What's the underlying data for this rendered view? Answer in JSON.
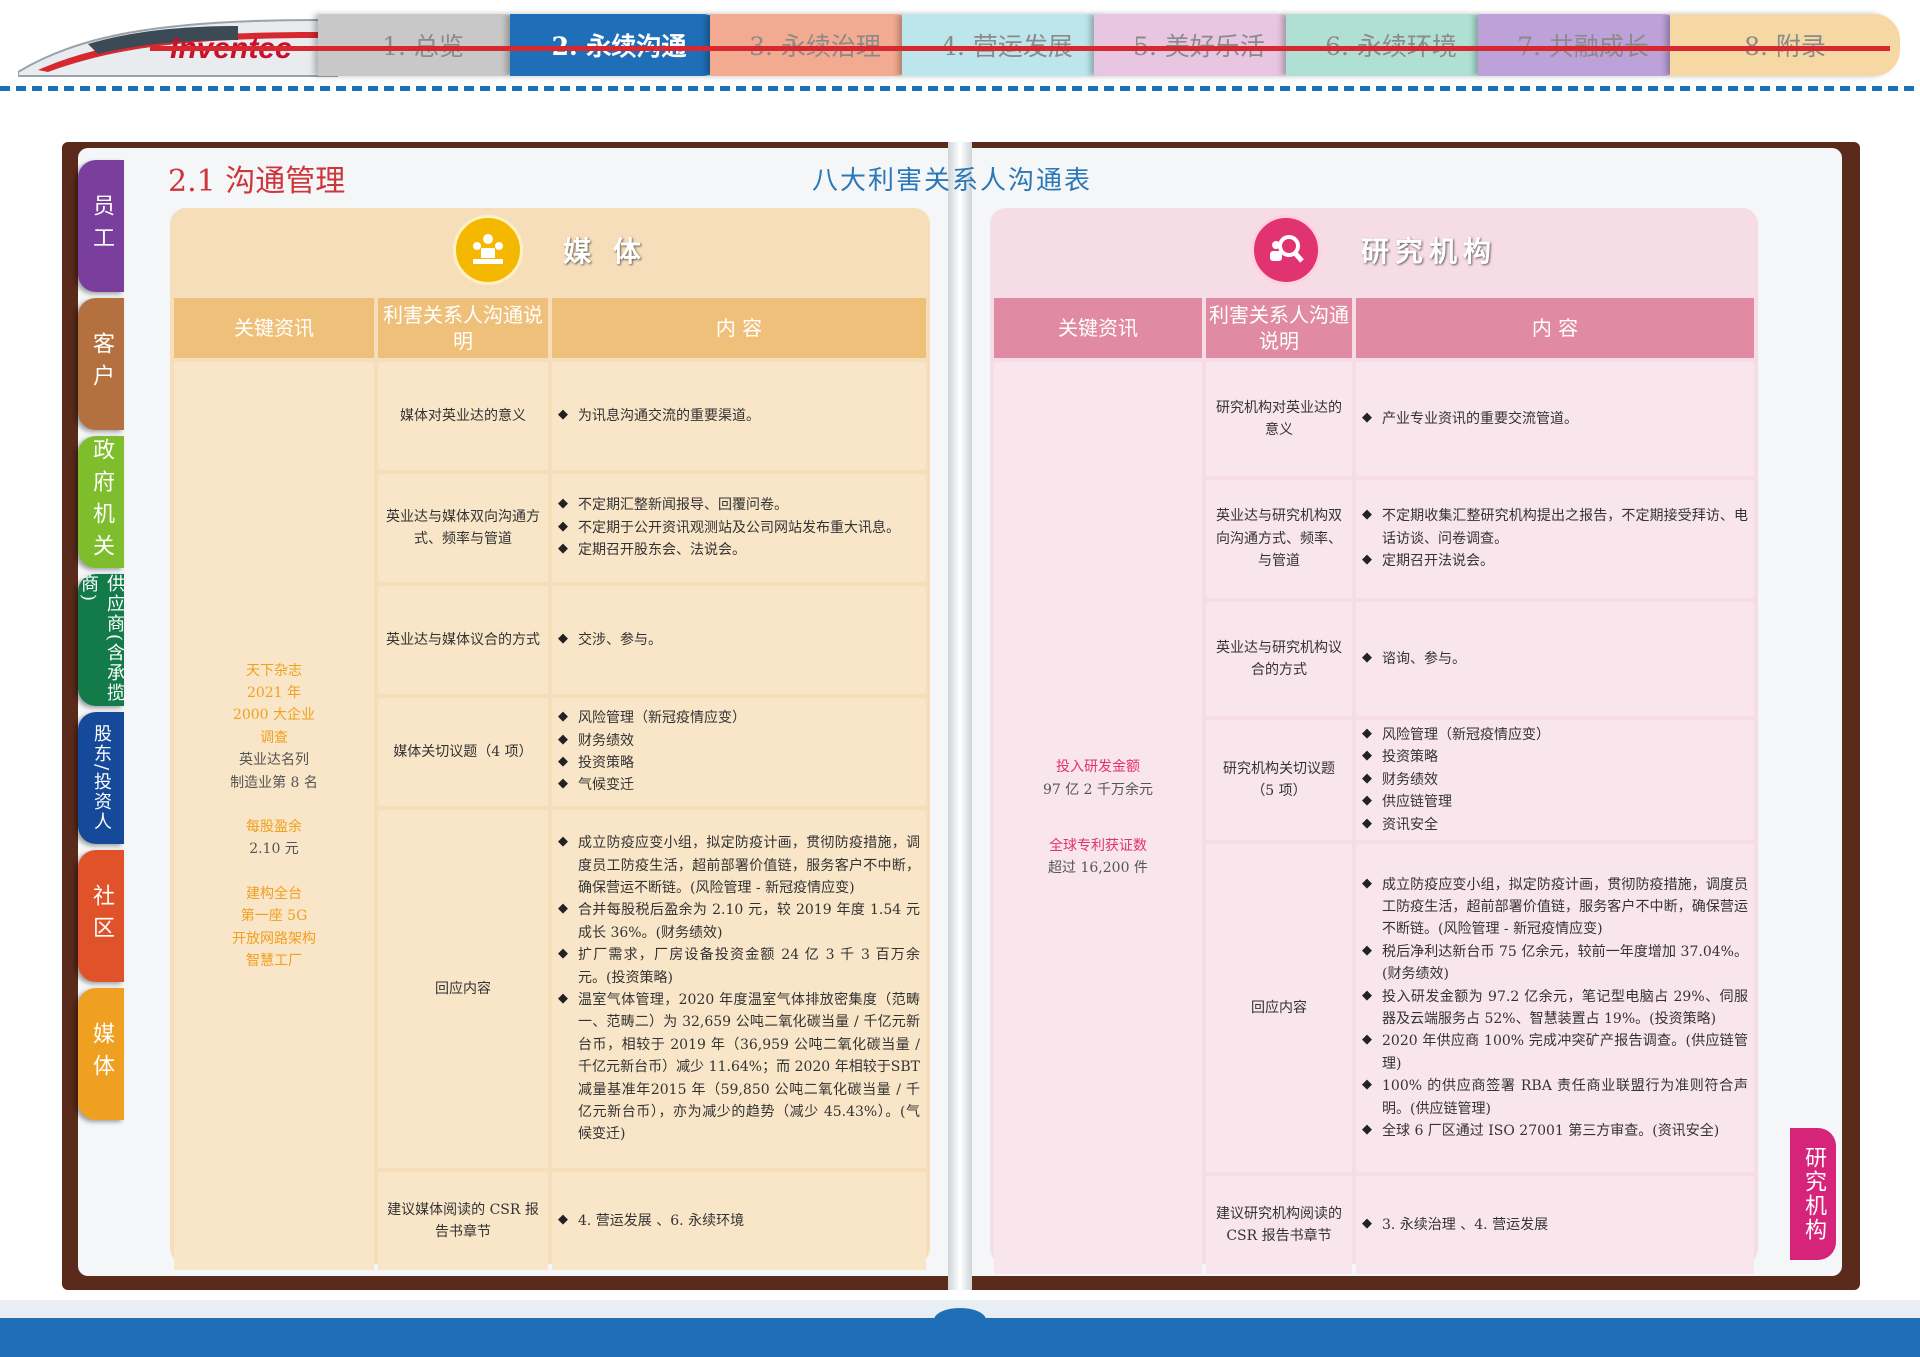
{
  "brand": {
    "logo_text": "Inventec"
  },
  "nav": {
    "tabs": [
      {
        "label": "1. 总览",
        "color": "#b9b9b9",
        "active": false
      },
      {
        "label": "2. 永续沟通",
        "color": "#1f6fb8",
        "active": true
      },
      {
        "label": "3. 永续治理",
        "color": "#f0a48a",
        "active": false
      },
      {
        "label": "4. 营运发展",
        "color": "#b7e3ea",
        "active": false
      },
      {
        "label": "5. 美好乐活",
        "color": "#e6bfe0",
        "active": false
      },
      {
        "label": "6. 永续环境",
        "color": "#a9ddd0",
        "active": false
      },
      {
        "label": "7. 共融成长",
        "color": "#b89ad6",
        "active": false
      },
      {
        "label": "8. 附录",
        "color": "#f5d39a",
        "active": false
      }
    ]
  },
  "section_title": "2.1 沟通管理",
  "table_title": "八大利害关系人沟通表",
  "side_tabs": [
    {
      "label": "员工",
      "color": "#7a3f9d"
    },
    {
      "label": "客户",
      "color": "#b5703f"
    },
    {
      "label": "政府机关",
      "color": "#7ebd2c"
    },
    {
      "label": "供应商(含承揽商)",
      "color": "#137a4a"
    },
    {
      "label": "股东/投资人",
      "color": "#154a9a"
    },
    {
      "label": "社区",
      "color": "#e0522a"
    },
    {
      "label": "媒体",
      "color": "#f0a020"
    }
  ],
  "right_tab": {
    "label": "研究机构"
  },
  "media": {
    "heading": "媒 体",
    "icon": "people-podium-icon",
    "columns": [
      "关键资讯",
      "利害关系人沟通说明",
      "内 容"
    ],
    "key_info": {
      "line1": "天下杂志",
      "line2": "2021 年",
      "line3": "2000 大企业",
      "line4": "调查",
      "line5": "英业达名列",
      "line6": "制造业第 8 名",
      "line7": "每股盈余",
      "line8": "2.10 元",
      "line9": "建构全台",
      "line10": "第一座 5G",
      "line11": "开放网路架构",
      "line12": "智慧工厂"
    },
    "rows": [
      {
        "desc": "媒体对英业达的意义",
        "items": [
          "为讯息沟通交流的重要渠道。"
        ]
      },
      {
        "desc": "英业达与媒体双向沟通方式、频率与管道",
        "items": [
          "不定期汇整新闻报导、回覆问卷。",
          "不定期于公开资讯观测站及公司网站发布重大讯息。",
          "定期召开股东会、法说会。"
        ]
      },
      {
        "desc": "英业达与媒体议合的方式",
        "items": [
          "交涉、参与。"
        ]
      },
      {
        "desc": "媒体关切议题（4 项）",
        "items": [
          "风险管理（新冠疫情应变）",
          "财务绩效",
          "投资策略",
          "气候变迁"
        ]
      },
      {
        "desc": "回应内容",
        "items": [
          "成立防疫应变小组，拟定防疫计画，贯彻防疫措施，调度员工防疫生活，超前部署价值链，服务客户不中断，确保营运不断链。(风险管理 - 新冠疫情应变)",
          "合并每股税后盈余为 2.10 元，较 2019 年度 1.54 元成长 36%。(财务绩效)",
          "扩厂需求，厂房设备投资金额 24 亿 3 千 3 百万余元。(投资策略)",
          "温室气体管理，2020 年度温室气体排放密集度（范畴一、范畴二）为 32,659 公吨二氧化碳当量 / 千亿元新台币，相较于 2019 年（36,959 公吨二氧化碳当量 / 千亿元新台币）减少 11.64%；而 2020 年相较于SBT减量基准年2015 年（59,850 公吨二氧化碳当量 / 千亿元新台币），亦为减少的趋势（减少 45.43%）。(气候变迁)"
        ]
      },
      {
        "desc": "建议媒体阅读的 CSR 报告书章节",
        "items": [
          "4. 营运发展 、6. 永续环境"
        ]
      }
    ]
  },
  "research": {
    "heading": "研究机构",
    "icon": "magnifier-person-icon",
    "columns": [
      "关键资讯",
      "利害关系人沟通说明",
      "内 容"
    ],
    "key_info": {
      "line1": "投入研发金额",
      "line2": "97 亿 2 千万余元",
      "line3": "全球专利获证数",
      "line4": "超过 16,200 件"
    },
    "rows": [
      {
        "desc": "研究机构对英业达的意义",
        "items": [
          "产业专业资讯的重要交流管道。"
        ]
      },
      {
        "desc": "英业达与研究机构双向沟通方式、频率、与管道",
        "items": [
          "不定期收集汇整研究机构提出之报告，不定期接受拜访、电话访谈、问卷调查。",
          "定期召开法说会。"
        ]
      },
      {
        "desc": "英业达与研究机构议合的方式",
        "items": [
          "谘询、参与。"
        ]
      },
      {
        "desc": "研究机构关切议题（5 项）",
        "items": [
          "风险管理（新冠疫情应变）",
          "投资策略",
          "财务绩效",
          "供应链管理",
          "资讯安全"
        ]
      },
      {
        "desc": "回应内容",
        "items": [
          "成立防疫应变小组，拟定防疫计画，贯彻防疫措施，调度员工防疫生活，超前部署价值链，服务客户不中断，确保营运不断链。(风险管理 - 新冠疫情应变)",
          "税后净利达新台币 75 亿余元，较前一年度增加 37.04%。(财务绩效)",
          "投入研发金额为 97.2 亿余元，笔记型电脑占 29%、伺服器及云端服务占 52%、智慧装置占 19%。(投资策略)",
          "2020 年供应商 100% 完成冲突矿产报告调查。(供应链管理)",
          "100% 的供应商签署 RBA 责任商业联盟行为准则符合声明。(供应链管理)",
          "全球 6 厂区通过 ISO 27001 第三方审查。(资讯安全)"
        ]
      },
      {
        "desc": "建议研究机构阅读的 CSR 报告书章节",
        "items": [
          "3. 永续治理 、4. 营运发展"
        ]
      }
    ]
  }
}
